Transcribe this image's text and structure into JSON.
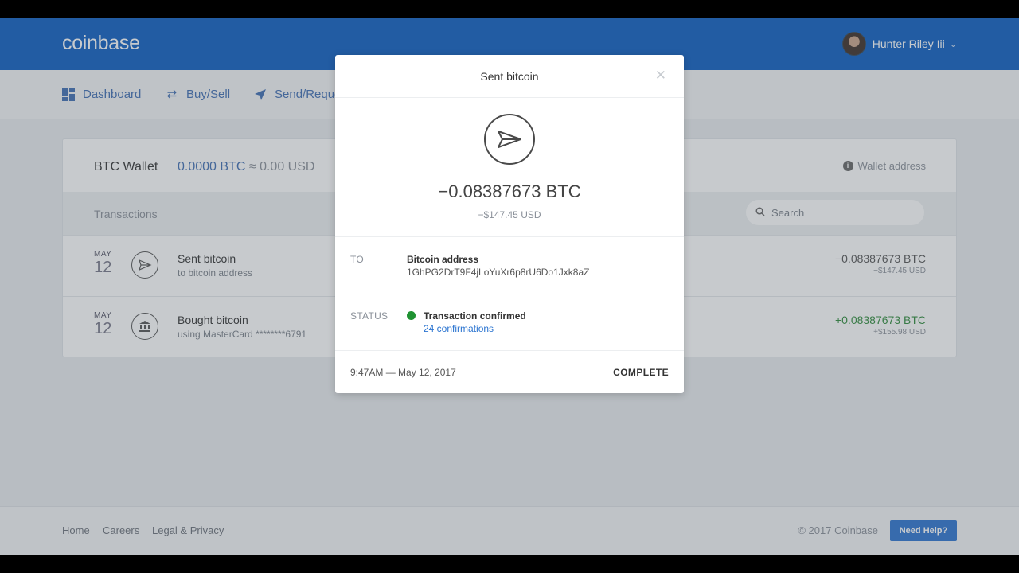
{
  "header": {
    "logo": "coinbase",
    "user_name": "Hunter Riley Iii"
  },
  "nav": {
    "items": [
      {
        "label": "Dashboard",
        "icon": "grid-icon"
      },
      {
        "label": "Buy/Sell",
        "icon": "swap-icon"
      },
      {
        "label": "Send/Request",
        "icon": "paper-plane-icon"
      }
    ]
  },
  "wallet": {
    "name": "BTC Wallet",
    "balance_btc": "0.0000 BTC",
    "approx": "≈",
    "balance_usd": "0.00 USD",
    "address_label": "Wallet address"
  },
  "transactions": {
    "title": "Transactions",
    "search_placeholder": "Search",
    "rows": [
      {
        "month": "MAY",
        "day": "12",
        "title": "Sent bitcoin",
        "subtitle": "to bitcoin address",
        "amount": "−0.08387673 BTC",
        "amount_usd": "−$147.45 USD",
        "direction": "out"
      },
      {
        "month": "MAY",
        "day": "12",
        "title": "Bought bitcoin",
        "subtitle": "using MasterCard ********6791",
        "amount": "+0.08387673 BTC",
        "amount_usd": "+$155.98 USD",
        "direction": "in"
      }
    ]
  },
  "modal": {
    "title": "Sent bitcoin",
    "amount_btc": "−0.08387673 BTC",
    "amount_usd": "−$147.45 USD",
    "to_label": "TO",
    "to_title": "Bitcoin address",
    "to_address": "1GhPG2DrT9F4jLoYuXr6p8rU6Do1Jxk8aZ",
    "status_label": "STATUS",
    "status_text": "Transaction confirmed",
    "confirmations": "24 confirmations",
    "timestamp": "9:47AM — May 12, 2017",
    "state": "COMPLETE",
    "status_color": "#1f9232"
  },
  "footer": {
    "links": [
      "Home",
      "Careers",
      "Legal & Privacy"
    ],
    "copyright": "© 2017 Coinbase",
    "help_button": "Need Help?"
  },
  "colors": {
    "brand": "#0c5dc1",
    "accent": "#2b74d0",
    "positive": "#2e8b3a"
  }
}
